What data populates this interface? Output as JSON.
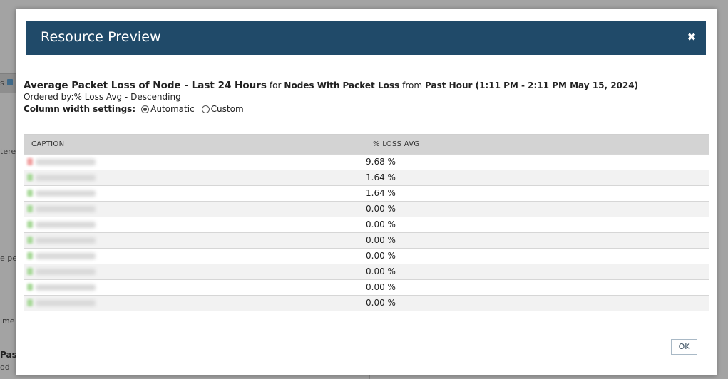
{
  "background_fragments": {
    "frag_s": "s",
    "frag_tere": "tere",
    "frag_epe": "e pe",
    "frag_ime": "ime",
    "frag_pas": "Pas",
    "frag_od": "od"
  },
  "modal": {
    "title": "Resource Preview",
    "close_glyph": "✖"
  },
  "report": {
    "title_main": "Average Packet Loss of Node - Last 24 Hours",
    "for_word": "for",
    "resource": "Nodes With Packet Loss",
    "from_word": "from",
    "timeframe": "Past Hour (1:11 PM - 2:11 PM May 15, 2024)",
    "ordered_by": "Ordered by:% Loss Avg - Descending",
    "column_width_label": "Column width settings:",
    "option_automatic": "Automatic",
    "option_custom": "Custom",
    "selected_option": "Automatic"
  },
  "table": {
    "columns": [
      "CAPTION",
      "% LOSS AVG"
    ],
    "rows": [
      {
        "status": "red",
        "value": "9.68 %"
      },
      {
        "status": "green",
        "value": "1.64 %"
      },
      {
        "status": "green",
        "value": "1.64 %"
      },
      {
        "status": "green",
        "value": "0.00 %"
      },
      {
        "status": "green",
        "value": "0.00 %"
      },
      {
        "status": "green",
        "value": "0.00 %"
      },
      {
        "status": "green",
        "value": "0.00 %"
      },
      {
        "status": "green",
        "value": "0.00 %"
      },
      {
        "status": "green",
        "value": "0.00 %"
      },
      {
        "status": "green",
        "value": "0.00 %"
      }
    ]
  },
  "buttons": {
    "ok_label": "OK"
  },
  "colors": {
    "header_bg": "#204a69",
    "status_red": "#f1a1a1",
    "status_green": "#a9d99a"
  }
}
